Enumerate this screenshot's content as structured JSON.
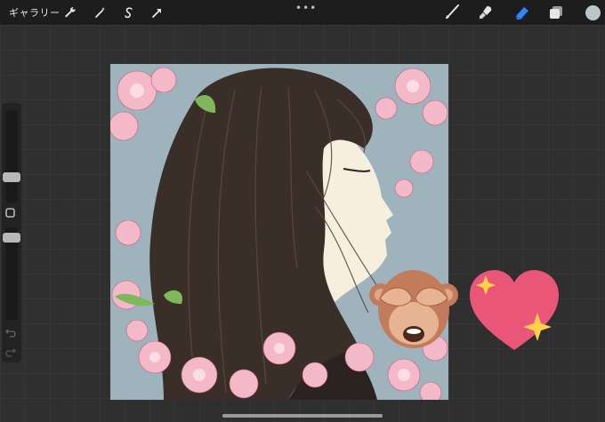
{
  "app": {
    "gallery_label": "ギャラリー"
  },
  "toolbar_left": [
    {
      "icon": "wrench-icon"
    },
    {
      "icon": "magic-wand-icon"
    },
    {
      "icon": "selection-s-icon"
    },
    {
      "icon": "arrow-cursor-icon"
    }
  ],
  "toolbar_right": [
    {
      "icon": "brush-icon"
    },
    {
      "icon": "smudge-icon"
    },
    {
      "icon": "eraser-icon",
      "active": true,
      "color": "#2f86ff"
    },
    {
      "icon": "layers-icon"
    },
    {
      "icon": "color-swatch-icon",
      "color": "#b9c7cd"
    }
  ],
  "sidebar": {
    "undo_icon": "undo-icon",
    "redo_icon": "redo-icon",
    "modifier_icon": "square-modifier-icon"
  },
  "canvas": {
    "background": "#9fb3bd",
    "stickers": [
      "see-no-evil-monkey-emoji",
      "sparkling-heart-emoji"
    ]
  },
  "colors": {
    "topbar": "#1d1d1e",
    "canvas_bg": "#2f2f30",
    "accent": "#2f86ff"
  }
}
